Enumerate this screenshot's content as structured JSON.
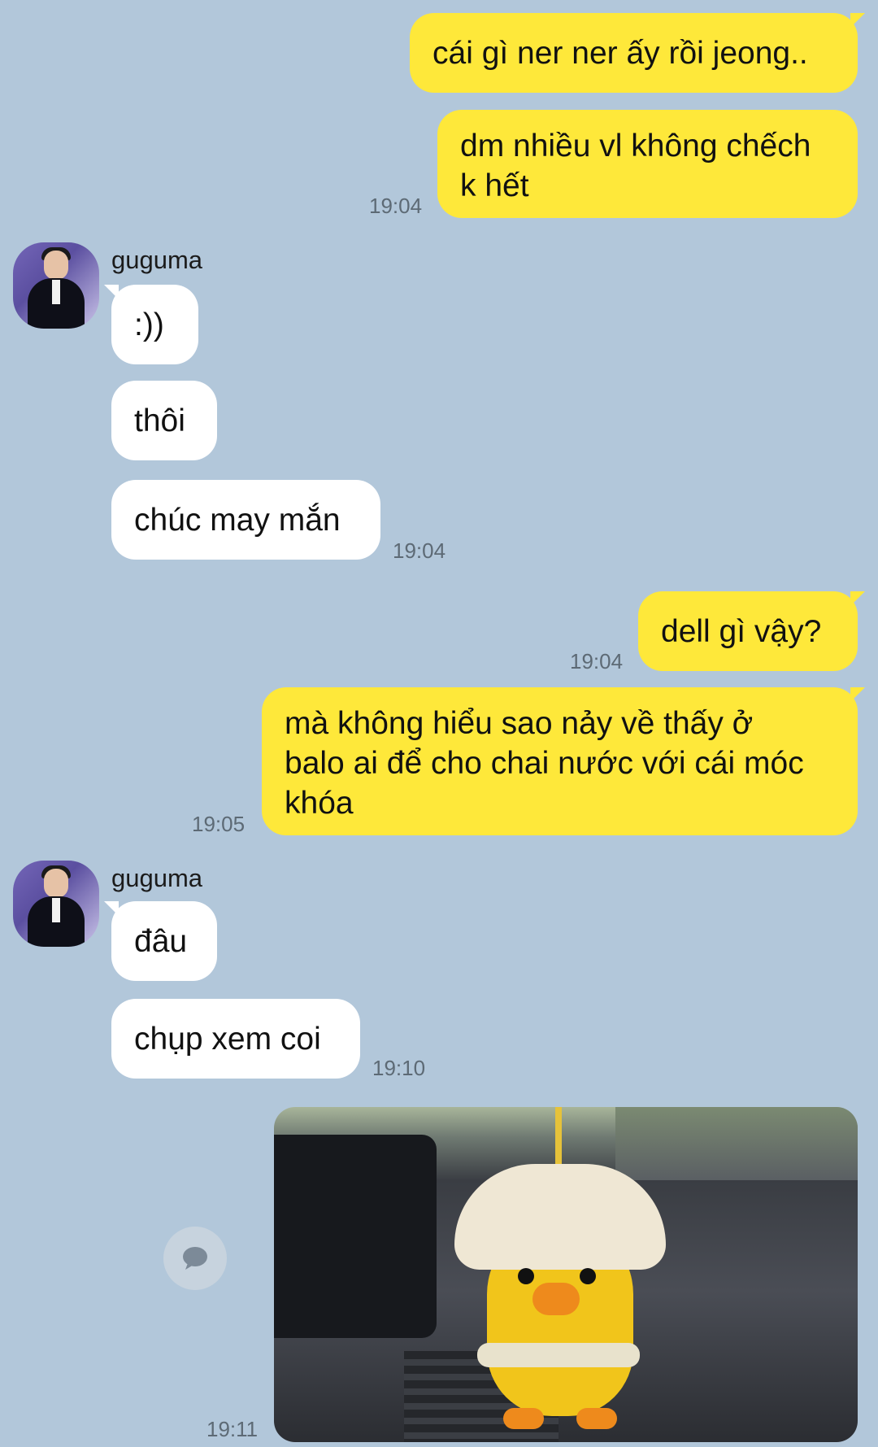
{
  "messages": [
    {
      "id": "m1",
      "from": "me",
      "text": "cái gì ner ner ấy rồi jeong.."
    },
    {
      "id": "m2",
      "from": "me",
      "lines": [
        "dm nhiều vl không chếch",
        "k hết"
      ],
      "time": "19:04"
    },
    {
      "id": "m3",
      "from": "them",
      "sender": "guguma",
      "text": ":))"
    },
    {
      "id": "m4",
      "from": "them",
      "text": "thôi"
    },
    {
      "id": "m5",
      "from": "them",
      "text": "chúc may mắn",
      "time": "19:04"
    },
    {
      "id": "m6",
      "from": "me",
      "text": "dell gì vậy?",
      "time": "19:04"
    },
    {
      "id": "m7",
      "from": "me",
      "lines": [
        "mà không hiểu sao nảy về thấy ở",
        "balo ai để cho chai nước với cái móc",
        "khóa"
      ],
      "time": "19:05"
    },
    {
      "id": "m8",
      "from": "them",
      "sender": "guguma",
      "text": "đâu"
    },
    {
      "id": "m9",
      "from": "them",
      "text": "chụp xem coi",
      "time": "19:10"
    },
    {
      "id": "m10",
      "from": "me",
      "type": "photo",
      "description_icon": "crochet-duck-keychain-photo",
      "time": "19:11"
    }
  ],
  "colors": {
    "background": "#b2c7da",
    "my_bubble": "#fee83a",
    "their_bubble": "#ffffff"
  },
  "icons": {
    "quick_action": "speech-bubble-icon"
  }
}
